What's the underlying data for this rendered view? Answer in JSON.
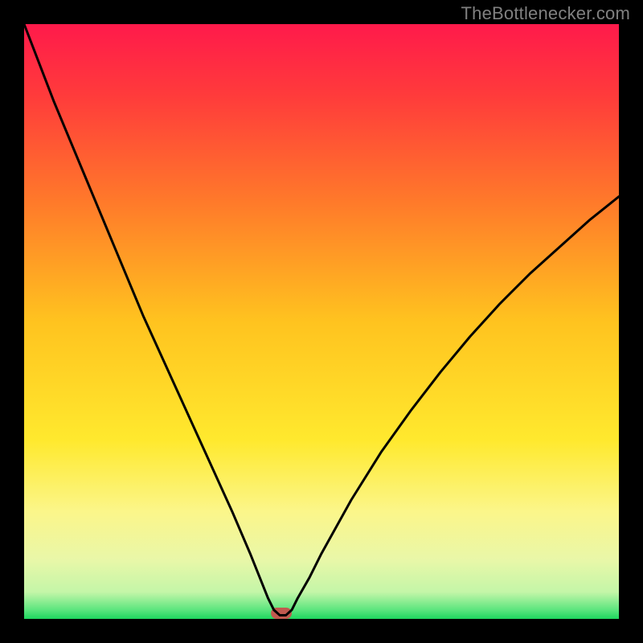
{
  "watermark": "TheBottlenecker.com",
  "chart_data": {
    "type": "line",
    "title": "",
    "xlabel": "",
    "ylabel": "",
    "xlim": [
      0,
      100
    ],
    "ylim": [
      0,
      100
    ],
    "series": [
      {
        "name": "curve",
        "x": [
          0,
          5,
          10,
          15,
          20,
          25,
          30,
          35,
          38,
          40,
          41,
          42,
          43,
          44,
          45,
          46,
          48,
          50,
          55,
          60,
          65,
          70,
          75,
          80,
          85,
          90,
          95,
          100
        ],
        "values": [
          100,
          87,
          75,
          63,
          51,
          40,
          29,
          18,
          11,
          6,
          3.5,
          1.5,
          0.6,
          0.6,
          1.5,
          3.5,
          7,
          11,
          20,
          28,
          35,
          41.5,
          47.5,
          53,
          58,
          62.5,
          67,
          71
        ]
      }
    ],
    "sweet_spot": {
      "x_start": 41.5,
      "x_end": 45.0
    },
    "gradient_stops": [
      {
        "offset": 0,
        "color": "#ff1a4b"
      },
      {
        "offset": 0.12,
        "color": "#ff3b3b"
      },
      {
        "offset": 0.3,
        "color": "#ff7a2a"
      },
      {
        "offset": 0.5,
        "color": "#ffc31f"
      },
      {
        "offset": 0.7,
        "color": "#ffe92e"
      },
      {
        "offset": 0.82,
        "color": "#fbf68a"
      },
      {
        "offset": 0.9,
        "color": "#e9f7a8"
      },
      {
        "offset": 0.955,
        "color": "#c4f6a8"
      },
      {
        "offset": 0.985,
        "color": "#5be57e"
      },
      {
        "offset": 1.0,
        "color": "#1ed65e"
      }
    ],
    "sweet_spot_color": "#c1594e",
    "curve_color": "#000000"
  }
}
